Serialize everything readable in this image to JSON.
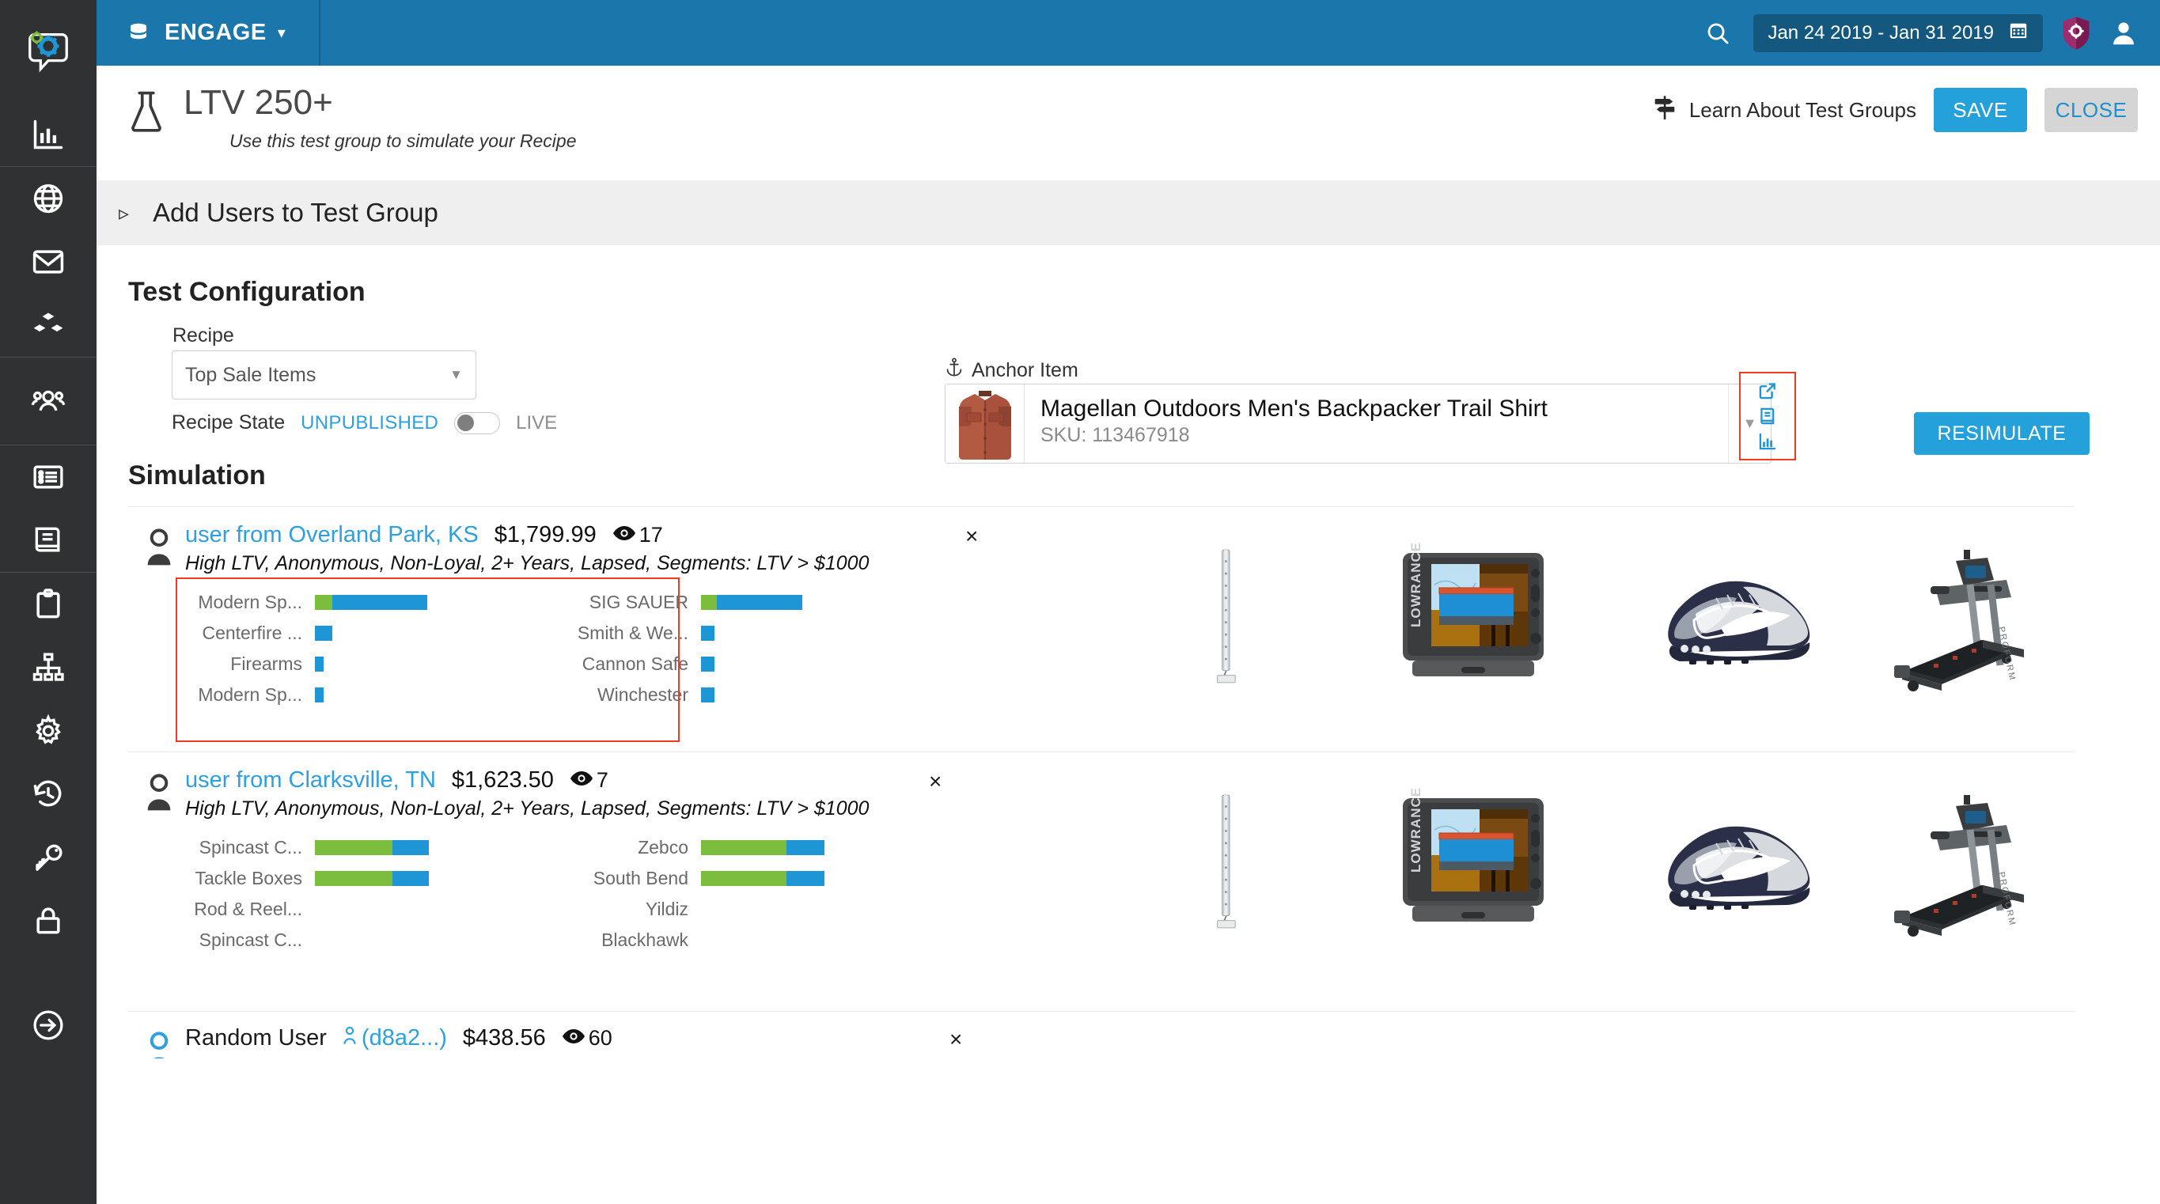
{
  "topbar": {
    "brand": "ENGAGE",
    "brand_icon": "database-icon",
    "caret": "▾",
    "search_icon": "search-icon",
    "date_range": "Jan 24 2019 - Jan 31 2019",
    "calendar_icon": "calendar-icon",
    "shield_icon": "shield-icon",
    "avatar_icon": "user-avatar-icon",
    "accent": "#1b76ac"
  },
  "page_header": {
    "flask_icon": "flask-icon",
    "title": "LTV 250+",
    "subtitle": "Use this test group to simulate your Recipe",
    "learn_link": "Learn About Test Groups",
    "learn_icon": "signpost-icon",
    "save_label": "SAVE",
    "close_label": "CLOSE",
    "save_color": "#24a0da",
    "close_color": "#d5d5d5"
  },
  "add_users": {
    "caret": "▹",
    "label": "Add Users to Test Group"
  },
  "test_configuration": {
    "title": "Test Configuration",
    "recipe_label": "Recipe",
    "recipe_value": "Top Sale Items",
    "recipe_caret": "▼",
    "recipe_state_label": "Recipe State",
    "state_unpublished": "UNPUBLISHED",
    "state_live": "LIVE",
    "toggle_on": false
  },
  "anchor_item": {
    "label": "Anchor Item",
    "anchor_icon": "anchor-icon",
    "name": "Magellan Outdoors Men's Backpacker Trail Shirt",
    "sku": "SKU: 113467918",
    "caret": "▼",
    "thumb": "product-thumb-shirt",
    "tools": [
      {
        "name": "external-link-icon"
      },
      {
        "name": "book-icon"
      },
      {
        "name": "bar-chart-icon"
      }
    ],
    "tools_highlight_color": "#f03b23"
  },
  "resimulate": {
    "label": "RESIMULATE"
  },
  "simulation": {
    "title": "Simulation",
    "highlight_color": "#f03b23",
    "bar_colors": {
      "green": "#7dbd3e",
      "blue": "#1e95d4"
    },
    "rows": [
      {
        "user_icon": "user-icon",
        "name": "user from Overland Park, KS",
        "name_is_link": true,
        "amount": "$1,799.99",
        "views_icon": "eye-icon",
        "views": "17",
        "close": "×",
        "description": "High LTV, Anonymous, Non-Loyal, 2+ Years, Lapsed, Segments: LTV > $1000",
        "highlighted": true,
        "bars_left": [
          {
            "label": "Modern Sp...",
            "green": 22,
            "blue": 120
          },
          {
            "label": "Centerfire ...",
            "green": 0,
            "blue": 22
          },
          {
            "label": "Firearms",
            "green": 0,
            "blue": 11
          },
          {
            "label": "Modern Sp...",
            "green": 0,
            "blue": 11
          }
        ],
        "bars_right": [
          {
            "label": "SIG SAUER",
            "green": 20,
            "blue": 108
          },
          {
            "label": "Smith & We...",
            "green": 0,
            "blue": 17
          },
          {
            "label": "Cannon Safe",
            "green": 0,
            "blue": 17
          },
          {
            "label": "Winchester",
            "green": 0,
            "blue": 17
          }
        ],
        "products": [
          "ladder-stand",
          "lowrance-fishfinder",
          "nike-shoe",
          "treadmill"
        ]
      },
      {
        "user_icon": "user-icon",
        "name": "user from Clarksville, TN",
        "name_is_link": true,
        "amount": "$1,623.50",
        "views_icon": "eye-icon",
        "views": "7",
        "close": "×",
        "description": "High LTV, Anonymous, Non-Loyal, 2+ Years, Lapsed, Segments: LTV > $1000",
        "highlighted": false,
        "bars_left": [
          {
            "label": "Spincast C...",
            "green": 98,
            "blue": 46
          },
          {
            "label": "Tackle Boxes",
            "green": 98,
            "blue": 46
          },
          {
            "label": "Rod & Reel...",
            "green": 0,
            "blue": 0
          },
          {
            "label": "Spincast C...",
            "green": 0,
            "blue": 0
          }
        ],
        "bars_right": [
          {
            "label": "Zebco",
            "green": 108,
            "blue": 48
          },
          {
            "label": "South Bend",
            "green": 108,
            "blue": 48
          },
          {
            "label": "Yildiz",
            "green": 0,
            "blue": 0
          },
          {
            "label": "Blackhawk",
            "green": 0,
            "blue": 0
          }
        ],
        "products": [
          "ladder-stand",
          "lowrance-fishfinder",
          "nike-shoe",
          "treadmill"
        ]
      }
    ],
    "partial_row": {
      "user_icon": "user-icon-blue",
      "name": "Random User",
      "link": "(d8a2...)",
      "link_person_icon": "person-icon",
      "amount": "$438.56",
      "views_icon": "eye-icon",
      "views": "60",
      "close": "×"
    }
  },
  "sidebar": {
    "logo": "engage-logo-icon",
    "items": [
      {
        "name": "analytics-bar-chart-icon"
      },
      {
        "name": "globe-icon"
      },
      {
        "name": "envelope-icon"
      },
      {
        "name": "blocks-icon"
      },
      {
        "name": "people-icon"
      },
      {
        "name": "list-icon"
      },
      {
        "name": "book-open-icon"
      },
      {
        "name": "clipboard-icon"
      },
      {
        "name": "sitemap-icon"
      },
      {
        "name": "gear-icon"
      },
      {
        "name": "history-icon"
      },
      {
        "name": "key-icon"
      },
      {
        "name": "lock-icon"
      },
      {
        "name": "logout-arrow-icon"
      }
    ]
  }
}
